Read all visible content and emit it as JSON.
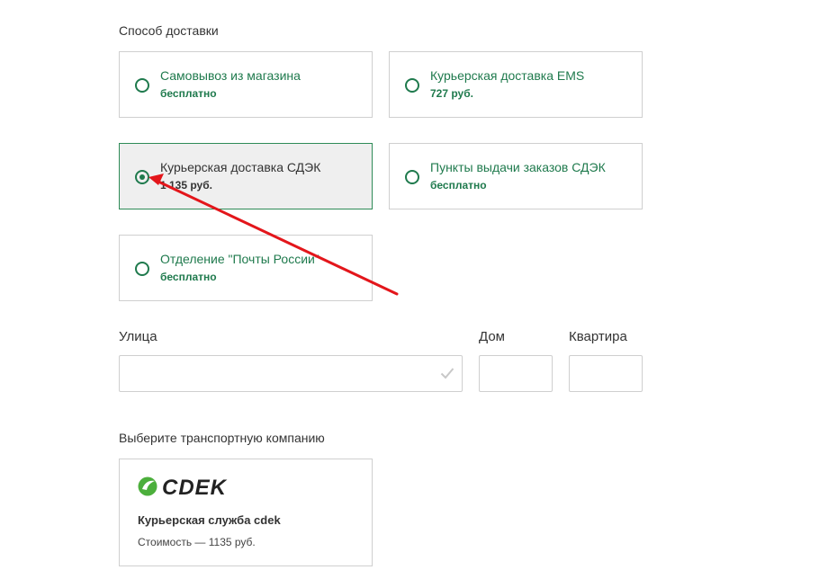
{
  "delivery": {
    "section_label": "Способ доставки",
    "options": [
      {
        "title": "Самовывоз из магазина",
        "price": "бесплатно",
        "selected": false
      },
      {
        "title": "Курьерская доставка EMS",
        "price": "727 руб.",
        "selected": false
      },
      {
        "title": "Курьерская доставка СДЭК",
        "price": "1 135 руб.",
        "selected": true
      },
      {
        "title": "Пункты выдачи заказов СДЭК",
        "price": "бесплатно",
        "selected": false
      },
      {
        "title": "Отделение \"Почты России\"",
        "price": "бесплатно",
        "selected": false
      }
    ]
  },
  "address": {
    "street_label": "Улица",
    "street_value": "",
    "house_label": "Дом",
    "house_value": "",
    "apartment_label": "Квартира",
    "apartment_value": ""
  },
  "transport": {
    "section_label": "Выберите транспортную компанию",
    "company": {
      "logo_text": "CDEK",
      "name": "Курьерская служба cdek",
      "cost": "Стоимость — 1135 руб."
    }
  },
  "colors": {
    "accent_green": "#1f7a4d",
    "logo_green": "#4caf3c",
    "annotation_arrow": "#e3161b",
    "selected_bg": "#efefef",
    "border": "#cfcfcf"
  },
  "icons": {
    "radio": "radio-button",
    "street_check": "checkmark-icon",
    "annotation": "arrow-annotation"
  }
}
